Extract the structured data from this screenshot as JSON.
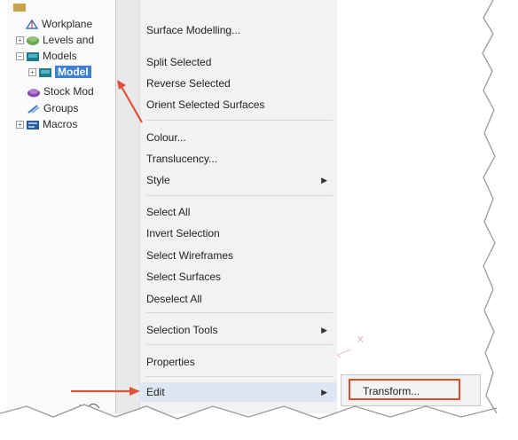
{
  "tree": {
    "items": [
      {
        "label": "Workplane",
        "expander": "",
        "icon": "workplane-icon"
      },
      {
        "label": "Levels and",
        "expander": "+",
        "icon": "levels-icon"
      },
      {
        "label": "Models",
        "expander": "−",
        "icon": "models-icon"
      },
      {
        "label": "Model",
        "expander": "+",
        "icon": "model-icon",
        "selected": true
      },
      {
        "label": "Stock Mod",
        "expander": "",
        "icon": "stock-model-icon"
      },
      {
        "label": "Groups",
        "expander": "",
        "icon": "groups-icon"
      },
      {
        "label": "Macros",
        "expander": "+",
        "icon": "macros-icon"
      }
    ]
  },
  "menu": {
    "items": [
      {
        "label": "Surface Modelling..."
      },
      {
        "label": "Split Selected"
      },
      {
        "label": "Reverse Selected"
      },
      {
        "label": "Orient Selected Surfaces"
      },
      {
        "label": "Colour..."
      },
      {
        "label": "Translucency..."
      },
      {
        "label": "Style",
        "submenu": true
      },
      {
        "label": "Select All"
      },
      {
        "label": "Invert Selection"
      },
      {
        "label": "Select Wireframes"
      },
      {
        "label": "Select Surfaces"
      },
      {
        "label": "Deselect All"
      },
      {
        "label": "Selection Tools",
        "submenu": true
      },
      {
        "label": "Properties"
      },
      {
        "label": "Edit",
        "submenu": true
      }
    ],
    "submenu_arrow": "▶"
  },
  "submenu": {
    "items": [
      {
        "label": "Transform..."
      }
    ]
  },
  "canvas": {
    "axis_label": "X"
  },
  "colors": {
    "annotation_arrow": "#e0533a",
    "highlight_box": "#e04a2f",
    "tree_selection": "#3d80d6"
  }
}
